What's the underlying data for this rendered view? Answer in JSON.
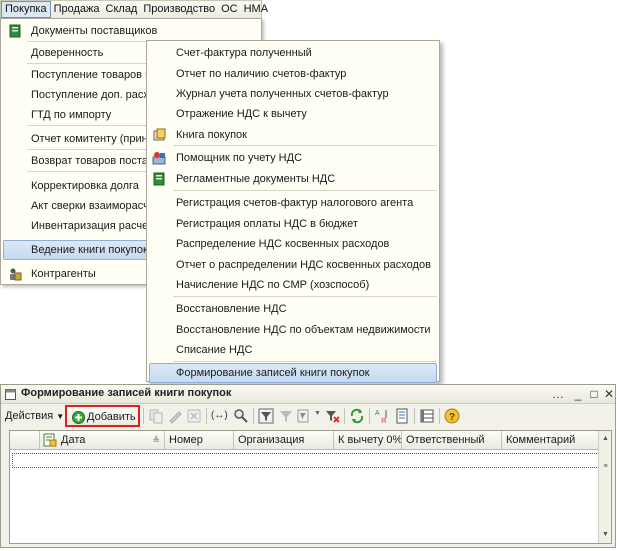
{
  "menubar": {
    "items": [
      "Покупка",
      "Продажа",
      "Склад",
      "Производство",
      "ОС",
      "НМА"
    ]
  },
  "menu1": {
    "items": [
      "Документы поставщиков",
      "Доверенность",
      "Поступление товаров и у",
      "Поступление доп. расход",
      "ГТД по импорту",
      "Отчет комитенту (принци",
      "Возврат товаров постави",
      "Корректировка долга",
      "Акт сверки взаиморасчет",
      "Инвентаризация расчетов",
      "Ведение книги покупок",
      "Контрагенты"
    ]
  },
  "menu2": {
    "items": [
      "Счет-фактура полученный",
      "Отчет по наличию счетов-фактур",
      "Журнал учета полученных счетов-фактур",
      "Отражение НДС к вычету",
      "Книга покупок",
      "Помощник по учету НДС",
      "Регламентные документы НДС",
      "Регистрация счетов-фактур налогового агента",
      "Регистрация оплаты НДС в бюджет",
      "Распределение НДС косвенных расходов",
      "Отчет о распределении НДС косвенных расходов",
      "Начисление НДС по СМР (хозспособ)",
      "Восстановление НДС",
      "Восстановление НДС по объектам недвижимости",
      "Списание НДС",
      "Формирование записей книги покупок"
    ]
  },
  "window": {
    "title": "Формирование записей книги покупок",
    "actions_label": "Действия",
    "add_label": "Добавить",
    "columns": [
      "Дата",
      "Номер",
      "Организация",
      "К вычету 0%",
      "Ответственный",
      "Комментарий"
    ]
  },
  "colors": {
    "highlight": "#c6daf1",
    "add_button_border": "#e0201c",
    "menu_background": "#fffff6"
  }
}
